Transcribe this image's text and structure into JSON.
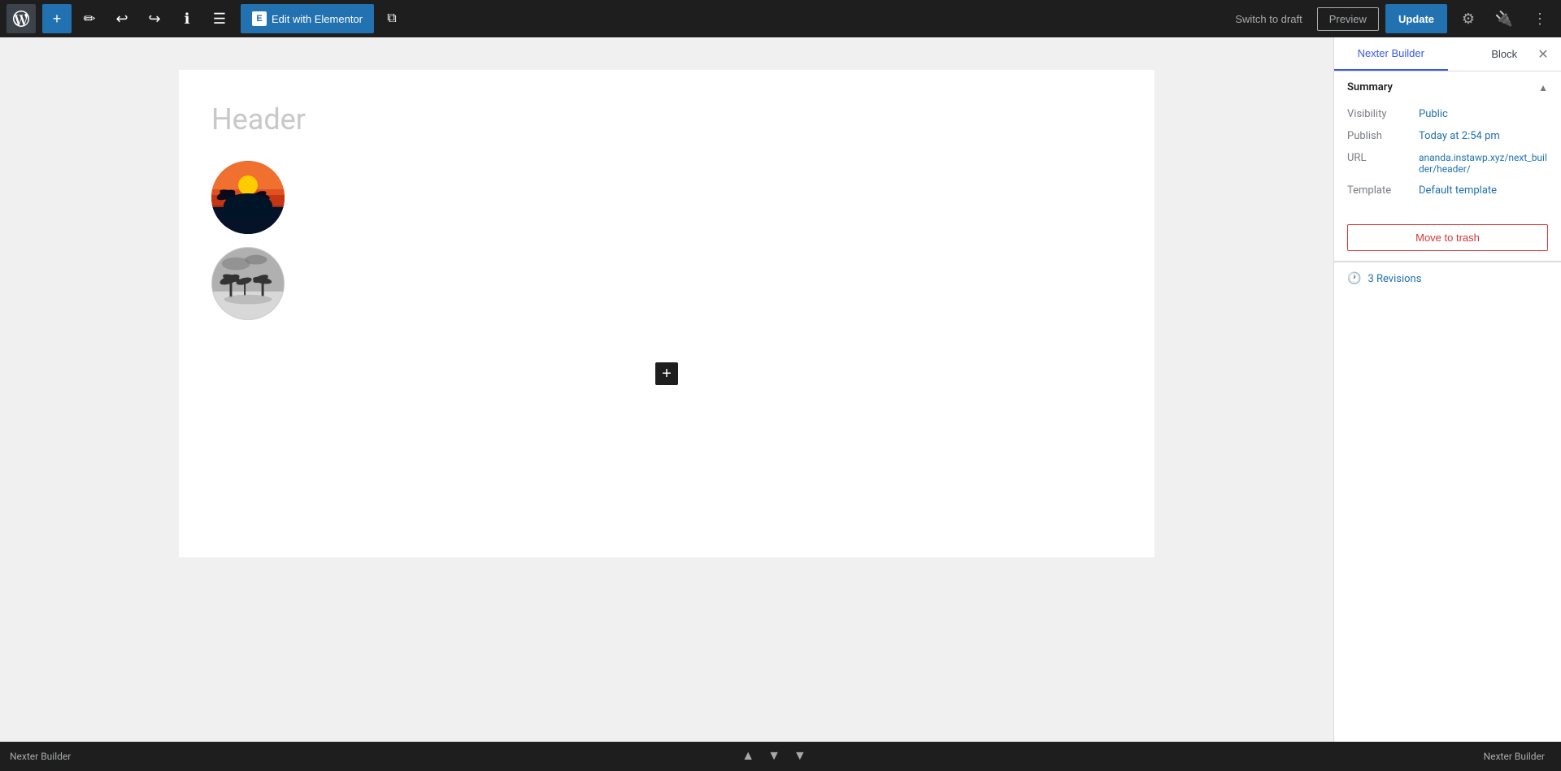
{
  "toolbar": {
    "add_label": "+",
    "edit_with_elementor_label": "Edit with Elementor",
    "elementor_icon": "E",
    "switch_to_draft_label": "Switch to draft",
    "preview_label": "Preview",
    "update_label": "Update"
  },
  "editor": {
    "page_title": "Header",
    "add_block_label": "+"
  },
  "right_panel": {
    "tab_nexter_builder": "Nexter Builder",
    "tab_block": "Block",
    "summary_title": "Summary",
    "visibility_label": "Visibility",
    "visibility_value": "Public",
    "publish_label": "Publish",
    "publish_value": "Today at 2:54 pm",
    "url_label": "URL",
    "url_value": "ananda.instawp.xyz/next_builder/header/",
    "template_label": "Template",
    "template_value": "Default template",
    "move_to_trash_label": "Move to trash",
    "revisions_label": "3 Revisions"
  },
  "bottom_bar": {
    "nexter_builder_label": "Nexter Builder",
    "breadcrumb_label": "Nexter Builder"
  }
}
